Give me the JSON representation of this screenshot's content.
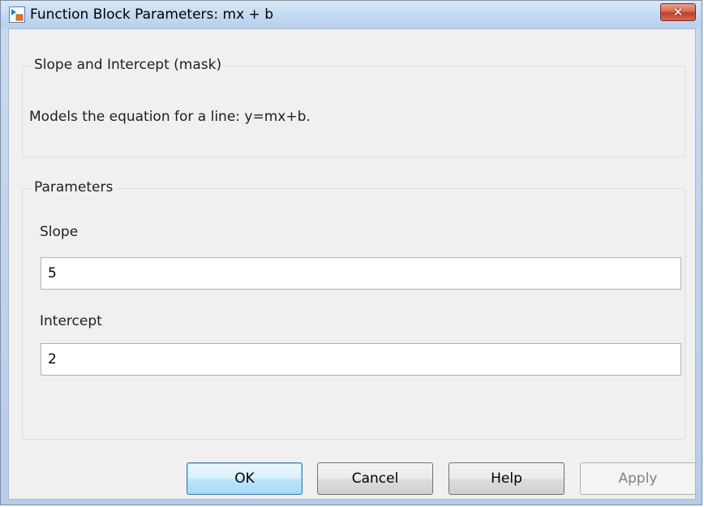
{
  "window": {
    "title": "Function Block Parameters: mx + b",
    "close_glyph": "✕",
    "icon": "simulink-block-icon"
  },
  "mask": {
    "group_title": "Slope and Intercept (mask)",
    "description": "Models the equation for a line: y=mx+b."
  },
  "parameters": {
    "group_title": "Parameters",
    "slope_label": "Slope",
    "slope_value": "5",
    "intercept_label": "Intercept",
    "intercept_value": "2"
  },
  "buttons": {
    "ok": "OK",
    "cancel": "Cancel",
    "help": "Help",
    "apply": "Apply",
    "apply_enabled": false
  },
  "colors": {
    "title_bar": "#c2d8f0",
    "close_button": "#c1402a",
    "default_button": "#a7d9f5"
  }
}
